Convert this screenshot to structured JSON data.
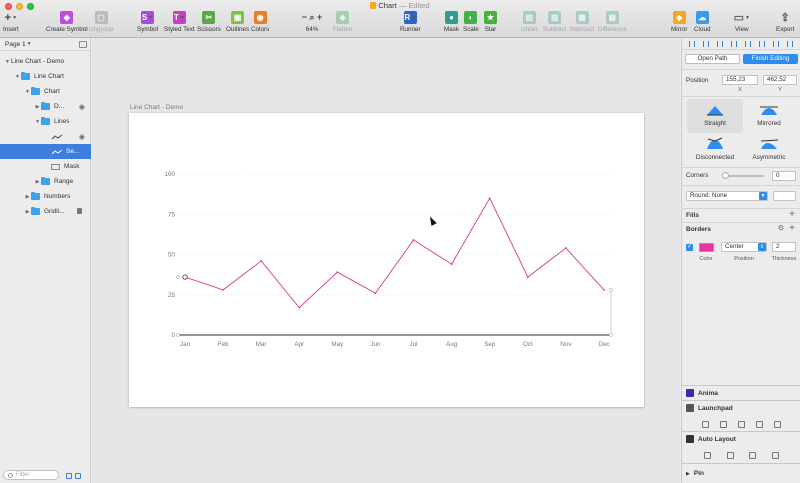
{
  "window": {
    "title": "Chart",
    "edited": "— Edited",
    "toolbar": [
      {
        "label": "Insert",
        "icon": "plus-icon",
        "color": "#444444",
        "enabled": true,
        "caret": true,
        "glyph": "+"
      },
      {
        "label": "Create Symbol",
        "icon": "create-symbol-icon",
        "color": "#c04de0",
        "enabled": true,
        "caret": false,
        "glyph": "◈"
      },
      {
        "label": "Ungroup",
        "icon": "ungroup-icon",
        "color": "#8d8d8d",
        "enabled": false,
        "caret": false,
        "glyph": "▢"
      },
      {
        "label": "Symbol",
        "icon": "symbol-icon",
        "color": "#a84bd8",
        "enabled": true,
        "caret": true,
        "glyph": "S"
      },
      {
        "label": "Styled Text",
        "icon": "styled-text-icon",
        "color": "#c440c6",
        "enabled": true,
        "caret": true,
        "glyph": "T"
      },
      {
        "label": "Scissors",
        "icon": "scissors-icon",
        "color": "#58a84b",
        "enabled": true,
        "caret": false,
        "glyph": "✂"
      },
      {
        "label": "Outlines",
        "icon": "outlines-icon",
        "color": "#7cc243",
        "enabled": true,
        "caret": false,
        "glyph": "▣"
      },
      {
        "label": "Colors",
        "icon": "colors-icon",
        "color": "#f07c2b",
        "enabled": true,
        "caret": false,
        "glyph": "◉"
      },
      {
        "label": "64%",
        "icon": "zoom-icon",
        "color": "#555555",
        "enabled": true,
        "caret": false,
        "glyph": "− ⌕ +"
      },
      {
        "label": "Flatten",
        "icon": "flatten-icon",
        "color": "#5ab56e",
        "enabled": false,
        "caret": false,
        "glyph": "◆"
      },
      {
        "label": "Runner",
        "icon": "runner-icon",
        "color": "#2c63c6",
        "enabled": true,
        "caret": true,
        "glyph": "R"
      },
      {
        "label": "Mask",
        "icon": "mask-icon",
        "color": "#2e9d8f",
        "enabled": true,
        "caret": false,
        "glyph": "●"
      },
      {
        "label": "Scale",
        "icon": "scale-icon",
        "color": "#44b04a",
        "enabled": true,
        "caret": false,
        "glyph": "◐"
      },
      {
        "label": "Star",
        "icon": "star-icon",
        "color": "#48b03d",
        "enabled": true,
        "caret": false,
        "glyph": "★"
      },
      {
        "label": "Union",
        "icon": "union-icon",
        "color": "#5fb0a8",
        "enabled": false,
        "caret": false,
        "glyph": "▧"
      },
      {
        "label": "Subtract",
        "icon": "subtract-icon",
        "color": "#5fb0a8",
        "enabled": false,
        "caret": false,
        "glyph": "▨"
      },
      {
        "label": "Intersect",
        "icon": "intersect-icon",
        "color": "#5fb0a8",
        "enabled": false,
        "caret": false,
        "glyph": "▩"
      },
      {
        "label": "Difference",
        "icon": "difference-icon",
        "color": "#5fb0a8",
        "enabled": false,
        "caret": false,
        "glyph": "▦"
      },
      {
        "label": "Mirror",
        "icon": "mirror-icon",
        "color": "#f5a623",
        "enabled": true,
        "caret": false,
        "glyph": "◆"
      },
      {
        "label": "Cloud",
        "icon": "cloud-icon",
        "color": "#3a9be8",
        "enabled": true,
        "caret": false,
        "glyph": "☁"
      },
      {
        "label": "View",
        "icon": "view-icon",
        "color": "#666666",
        "enabled": true,
        "caret": true,
        "glyph": "▭"
      },
      {
        "label": "Export",
        "icon": "export-icon",
        "color": "#555555",
        "enabled": true,
        "caret": false,
        "glyph": "⇪"
      }
    ]
  },
  "sidebar": {
    "page": "Page 1",
    "filter_placeholder": "Filter",
    "layers": [
      {
        "label": "Line Chart - Demo",
        "type": "artboard",
        "indent": 0,
        "open": true
      },
      {
        "label": "Line Chart",
        "type": "folder",
        "indent": 1,
        "open": true
      },
      {
        "label": "Chart",
        "type": "folder",
        "indent": 2,
        "open": true
      },
      {
        "label": "D...",
        "type": "folder",
        "indent": 3,
        "open": false,
        "eye": true
      },
      {
        "label": "Lines",
        "type": "folder",
        "indent": 3,
        "open": true
      },
      {
        "label": "",
        "type": "line",
        "indent": 4,
        "eye": true
      },
      {
        "label": "Se...",
        "type": "line",
        "indent": 4,
        "selected": true
      },
      {
        "label": "Mask",
        "type": "rect",
        "indent": 4
      },
      {
        "label": "Range",
        "type": "folder",
        "indent": 3,
        "open": false
      },
      {
        "label": "Numbers",
        "type": "folder",
        "indent": 2,
        "open": false
      },
      {
        "label": "Gridli...",
        "type": "folder",
        "indent": 2,
        "open": false,
        "lock": true
      }
    ]
  },
  "canvas": {
    "artboard_label": "Line Chart - Demo"
  },
  "chart_data": {
    "type": "line",
    "categories": [
      "Jan",
      "Feb",
      "Mar",
      "Apr",
      "May",
      "Jun",
      "Jul",
      "Aug",
      "Sep",
      "Oct",
      "Nov",
      "Dec"
    ],
    "values": [
      36,
      28,
      46,
      17,
      39,
      26,
      59,
      44,
      85,
      36,
      54,
      28
    ],
    "yticks": [
      "0",
      "25",
      "50",
      "75",
      "100"
    ],
    "ylim": [
      0,
      100
    ],
    "grid": true,
    "line_color": "#d6378f",
    "grid_color": "#e3e6e9",
    "axis_color": "#9aa3ab"
  },
  "inspector": {
    "open_path": "Open Path",
    "finish_editing": "Finish Editing",
    "position_label": "Position",
    "x_value": "155,23",
    "y_value": "462,52",
    "x_label": "X",
    "y_label": "Y",
    "point_types": [
      "Straight",
      "Mirrored",
      "Disconnected",
      "Asymmetric"
    ],
    "corners_label": "Corners",
    "corners_value": "0",
    "round_label": "Round: None",
    "fills_label": "Fills",
    "borders_label": "Borders",
    "border_color": "#e8359b",
    "border_position": "Center",
    "border_thickness": "2",
    "color_label": "Color",
    "position_sub": "Position",
    "thickness_label": "Thickness",
    "plugins": [
      "Anima",
      "Launchpad",
      "Auto Layout",
      "Pin"
    ]
  }
}
